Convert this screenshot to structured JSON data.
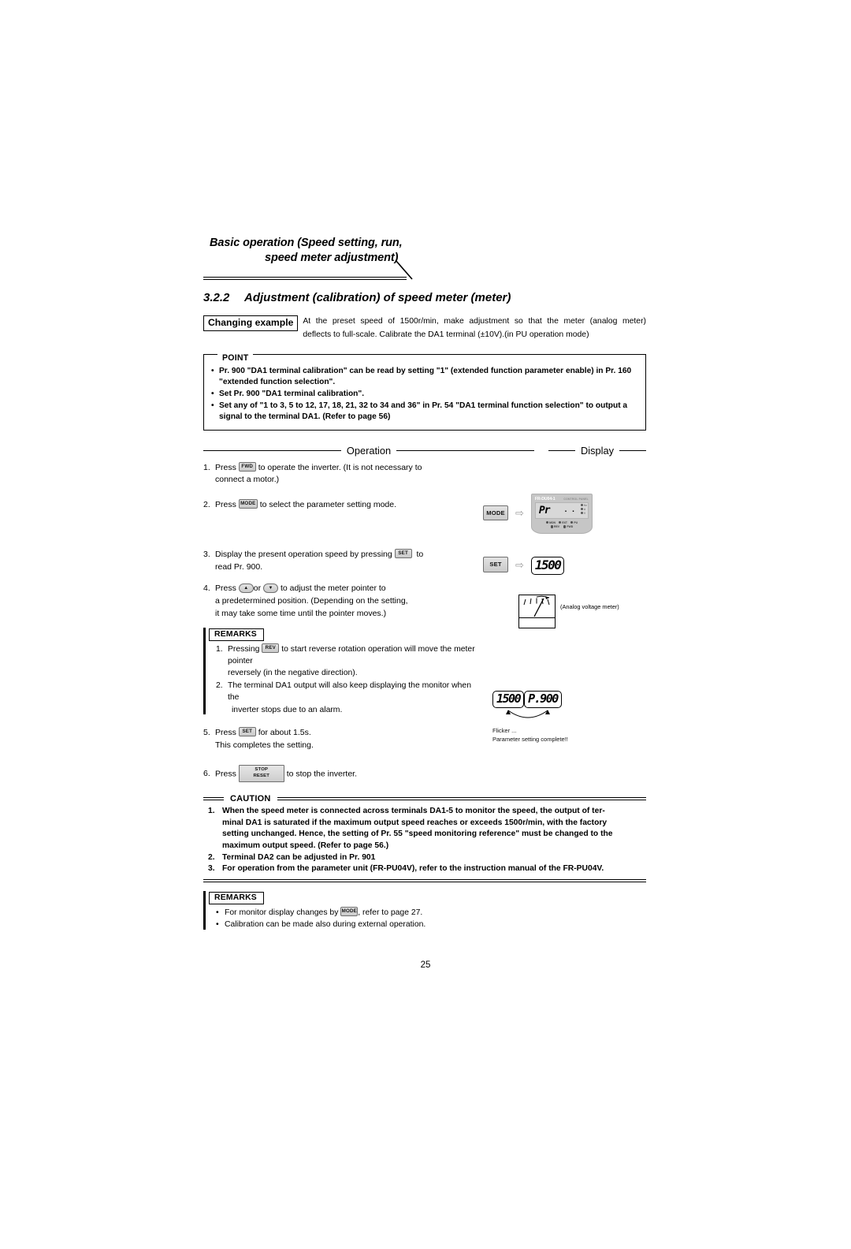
{
  "header": {
    "line1": "Basic operation (Speed setting, run,",
    "line2": "speed meter adjustment)"
  },
  "section": {
    "number": "3.2.2",
    "title": "Adjustment (calibration) of speed meter (meter)"
  },
  "changing_example": {
    "tag": "Changing example",
    "line1": "At the preset speed of 1500r/min, make adjustment so that the meter (analog meter)",
    "line2": "deflects to full-scale. Calibrate the DA1 terminal (±10V).(in PU operation mode)"
  },
  "point": {
    "tag": "POINT",
    "items": [
      "Pr. 900 \"DA1 terminal calibration\" can be read by setting \"1\" (extended function parameter enable) in Pr. 160 \"extended function selection\".",
      "Set Pr. 900 \"DA1 terminal calibration\".",
      "Set any of \"1 to 3, 5 to 12, 17, 18, 21, 32 to 34 and 36\" in Pr. 54 \"DA1 terminal function selection\" to output a signal to the terminal DA1. (Refer to page 56)"
    ]
  },
  "columns": {
    "operation_label": "Operation",
    "display_label": "Display"
  },
  "keys": {
    "fwd": "FWD",
    "mode": "MODE",
    "set": "SET",
    "rev": "REV",
    "up": "▲",
    "down": "▼",
    "stop_line1": "STOP",
    "stop_line2": "RESET"
  },
  "steps": [
    {
      "n": "1.",
      "pre": "Press",
      "key": "FWD",
      "post": "to operate the inverter. (It is not necessary to",
      "line2": "connect a motor.)"
    },
    {
      "n": "2.",
      "pre": "Press",
      "key": "MODE",
      "post": "to select the parameter setting mode.",
      "line2": ""
    },
    {
      "n": "3.",
      "pre": "Display the present operation speed by pressing",
      "key": "SET",
      "post": "to",
      "line2": "read Pr. 900."
    },
    {
      "n": "4.",
      "pre": "Press",
      "key": "▲",
      "key2": "▼",
      "mid": "or",
      "post": "to adjust the meter pointer to",
      "line2": "a predetermined position. (Depending on the setting,",
      "line3": "it may take some time until the pointer moves.)"
    },
    {
      "n": "5.",
      "pre": "Press",
      "key": "SET",
      "post": "for about 1.5s.",
      "line2": "This completes the setting."
    },
    {
      "n": "6.",
      "pre": "Press",
      "key": "STOP RESET",
      "post": "to stop the inverter.",
      "line2": ""
    }
  ],
  "remarks_mid": {
    "tag": "REMARKS",
    "items": [
      {
        "n": "1.",
        "pre": "Pressing",
        "key": "REV",
        "post": "to start reverse rotation operation will move the meter pointer",
        "line2": "reversely (in the negative direction)."
      },
      {
        "n": "2.",
        "pre": "The terminal DA1 output will also keep displaying the monitor when the",
        "key": "",
        "post": "",
        "line2": "inverter stops due to an alarm."
      }
    ]
  },
  "caution": {
    "tag": "CAUTION",
    "items": [
      {
        "n": "1.",
        "lines": [
          "When the speed meter is connected across terminals DA1-5 to monitor the speed, the output of ter-",
          "minal DA1 is saturated if the maximum output speed reaches or exceeds 1500r/min, with the factory",
          "setting unchanged. Hence, the setting of Pr. 55 \"speed monitoring reference\" must be changed to the",
          "maximum output speed. (Refer to page 56.)"
        ]
      },
      {
        "n": "2.",
        "lines": [
          "Terminal DA2 can be adjusted in Pr. 901"
        ]
      },
      {
        "n": "3.",
        "lines": [
          "For operation from the parameter unit (FR-PU04V), refer to the instruction manual of the FR-PU04V."
        ]
      }
    ]
  },
  "remarks_bottom": {
    "tag": "REMARKS",
    "items": [
      {
        "bullet": "•",
        "pre": "For monitor display changes by",
        "key": "MODE",
        "post": ", refer to page 27."
      },
      {
        "bullet": "•",
        "pre": "Calibration can be made also during external operation.",
        "key": "",
        "post": ""
      }
    ]
  },
  "display_col": {
    "panel": {
      "brand": "FR-DU04-",
      "brand_suffix": "1",
      "control_panel": "CONTROL PANEL",
      "segment": "Pr",
      "dots": ". .",
      "units": [
        "Hz",
        "A",
        "V"
      ],
      "leds_row1": [
        "MON",
        "EXT",
        "PU"
      ],
      "leds_row2": [
        "REV",
        "FWD"
      ]
    },
    "lcd_step3": "1500",
    "lcd_step5_left": "1500",
    "lcd_step5_right": "P.900",
    "meter_caption": "(Analog voltage meter)",
    "flicker_line1": "Flicker ...",
    "flicker_line2": "Parameter setting complete!!",
    "arrow": "⇨"
  },
  "page_number": "25"
}
